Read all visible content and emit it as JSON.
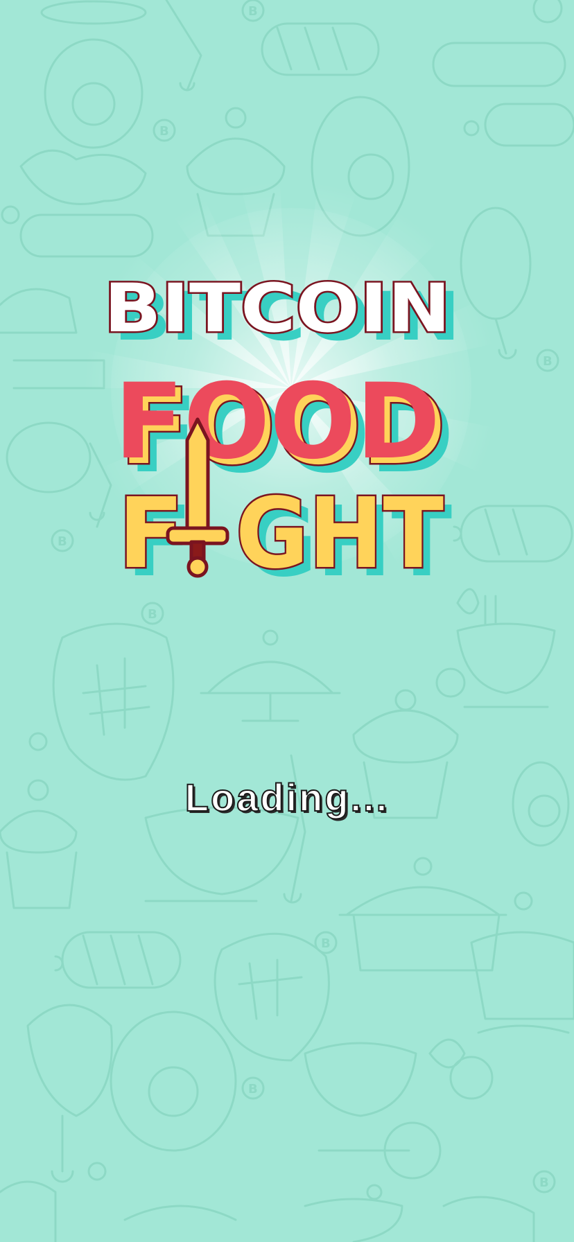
{
  "title": {
    "line1": "BITCOIN",
    "line2": "FOOD",
    "line3_part1": "F",
    "line3_part2": "GHT"
  },
  "status": {
    "loading_text": "Loading..."
  },
  "icons": {
    "background": "food-doodle-pattern",
    "logo_i": "sword-icon"
  },
  "colors": {
    "background": "#a2e7d6",
    "doodle_stroke": "#8dd9c5",
    "title_white": "#ffffff",
    "food_red": "#ec4a5c",
    "fight_yellow": "#ffd35a",
    "outline": "#7a1420",
    "shadow_teal": "#3ccfc3"
  }
}
